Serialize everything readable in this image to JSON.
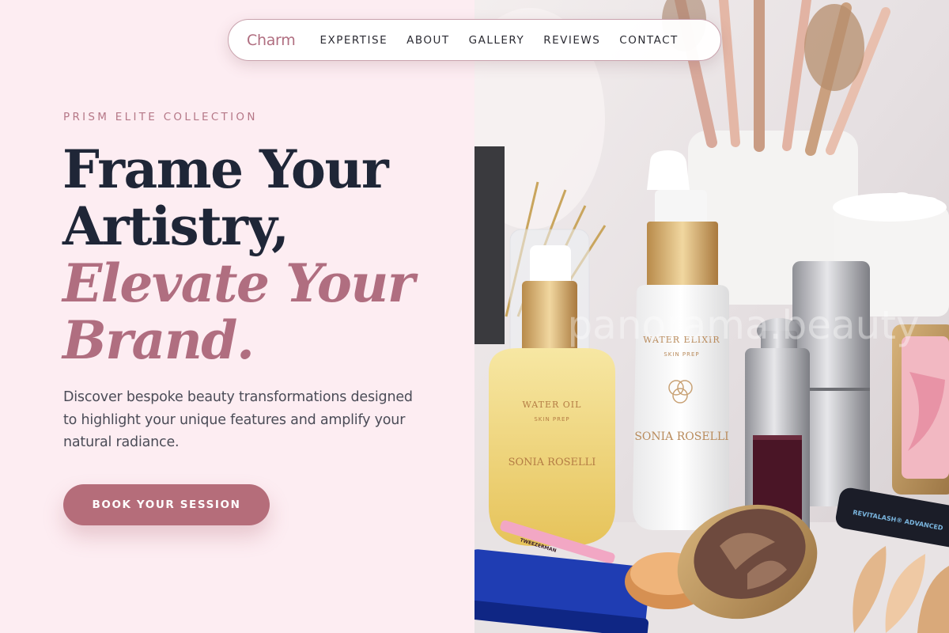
{
  "nav": {
    "brand": "Charm",
    "links": [
      "EXPERTISE",
      "ABOUT",
      "GALLERY",
      "REVIEWS",
      "CONTACT"
    ]
  },
  "hero": {
    "eyebrow": "PRISM ELITE COLLECTION",
    "headline_line1": "Frame Your",
    "headline_line2": "Artistry,",
    "headline_accent1": "Elevate Your",
    "headline_accent2": "Brand.",
    "description": "Discover bespoke beauty transformations designed to highlight your unique features and amplify your natural radiance.",
    "cta_label": "BOOK YOUR SESSION"
  },
  "image": {
    "watermark": "panorama.beauty",
    "label_water_oil": "WATER OIL",
    "label_skin_prep": "SKIN PREP",
    "label_brand": "SONIA ROSELLI",
    "label_water_elixir": "WATER ELIXIR",
    "label_tweezer": "TWEEZERMAN",
    "label_revitalash": "REVITALASH® ADVANCED"
  },
  "colors": {
    "accent": "#b06e80",
    "button": "#b56d7a",
    "headline_dark": "#1f2637",
    "panel_bg": "#fdedf2"
  }
}
